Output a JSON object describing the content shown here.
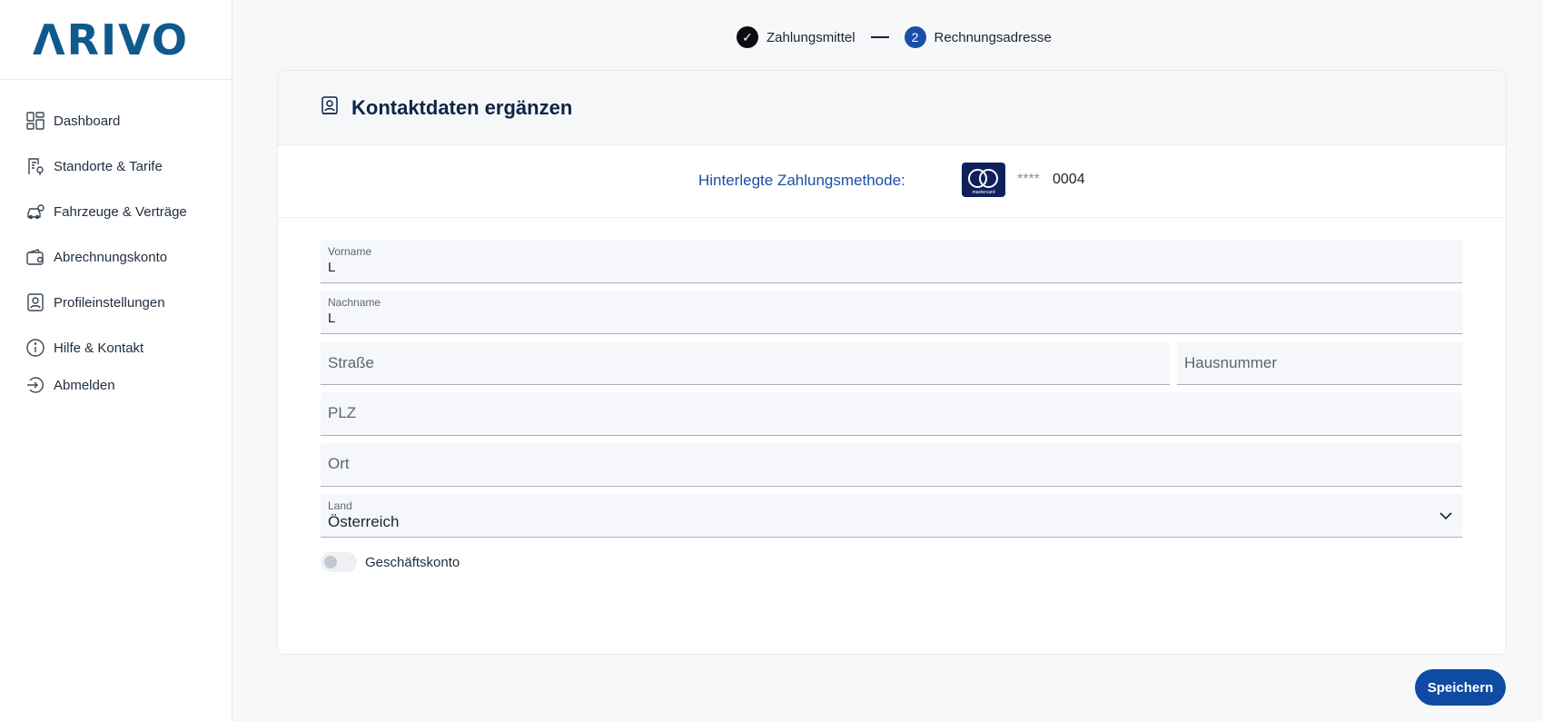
{
  "brand": {
    "logo_text": "ΛRIVO",
    "color": "#0f5a8d"
  },
  "sidebar": {
    "items": [
      {
        "label": "Dashboard",
        "icon": "dashboard-icon"
      },
      {
        "label": "Standorte & Tarife",
        "icon": "location-tariff-icon"
      },
      {
        "label": "Fahrzeuge & Verträge",
        "icon": "vehicle-settings-icon"
      },
      {
        "label": "Abrechnungskonto",
        "icon": "wallet-icon"
      },
      {
        "label": "Profileinstellungen",
        "icon": "profile-icon"
      },
      {
        "label": "Hilfe & Kontakt",
        "icon": "info-icon"
      },
      {
        "label": "Abmelden",
        "icon": "logout-icon"
      }
    ]
  },
  "stepper": {
    "steps": [
      {
        "label": "Zahlungsmittel",
        "state": "done",
        "marker": "✓"
      },
      {
        "label": "Rechnungsadresse",
        "state": "active",
        "marker": "2"
      }
    ]
  },
  "card": {
    "title": "Kontaktdaten ergänzen",
    "title_icon": "contact-card-icon",
    "payment": {
      "label": "Hinterlegte Zahlungsmethode:",
      "card_brand": "mastercard",
      "mask": "****",
      "last4": "0004"
    }
  },
  "form": {
    "vorname": {
      "label": "Vorname",
      "value": "L"
    },
    "nachname": {
      "label": "Nachname",
      "value": "L"
    },
    "strasse": {
      "placeholder": "Straße"
    },
    "hausnummer": {
      "placeholder": "Hausnummer"
    },
    "plz": {
      "placeholder": "PLZ"
    },
    "ort": {
      "placeholder": "Ort"
    },
    "land": {
      "label": "Land",
      "value": "Österreich"
    },
    "business_toggle": {
      "label": "Geschäftskonto",
      "on": false
    }
  },
  "actions": {
    "save_label": "Speichern"
  },
  "colors": {
    "primary": "#1a4fa8",
    "button": "#0f4aa3",
    "field_bg": "#f5f7fb"
  }
}
